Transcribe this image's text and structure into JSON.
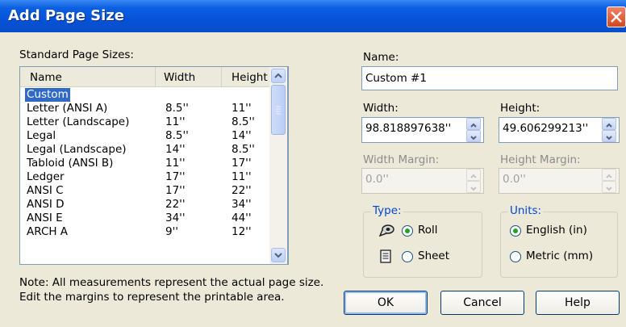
{
  "window": {
    "title": "Add Page Size"
  },
  "left": {
    "list_label": "Standard Page Sizes:",
    "columns": [
      "Name",
      "Width",
      "Height"
    ],
    "rows": [
      {
        "name": "Custom",
        "width": "",
        "height": ""
      },
      {
        "name": "Letter (ANSI A)",
        "width": "8.5''",
        "height": "11''"
      },
      {
        "name": "Letter (Landscape)",
        "width": "11''",
        "height": "8.5''"
      },
      {
        "name": "Legal",
        "width": "8.5''",
        "height": "14''"
      },
      {
        "name": "Legal (Landscape)",
        "width": "14''",
        "height": "8.5''"
      },
      {
        "name": "Tabloid (ANSI B)",
        "width": "11''",
        "height": "17''"
      },
      {
        "name": "Ledger",
        "width": "17''",
        "height": "11''"
      },
      {
        "name": "ANSI C",
        "width": "17''",
        "height": "22''"
      },
      {
        "name": "ANSI D",
        "width": "22''",
        "height": "34''"
      },
      {
        "name": "ANSI E",
        "width": "34''",
        "height": "44''"
      },
      {
        "name": "ARCH A",
        "width": "9''",
        "height": "12''"
      }
    ],
    "note_line1": "Note:  All measurements represent the actual page size.",
    "note_line2": "Edit the margins to represent the printable area."
  },
  "right": {
    "name_label": "Name:",
    "name_value": "Custom #1",
    "width_label": "Width:",
    "width_value": "98.818897638''",
    "height_label": "Height:",
    "height_value": "49.606299213''",
    "width_margin_label": "Width Margin:",
    "width_margin_value": "0.0''",
    "height_margin_label": "Height Margin:",
    "height_margin_value": "0.0''",
    "type_group": "Type:",
    "type_roll": "Roll",
    "type_sheet": "Sheet",
    "units_group": "Units:",
    "units_english": "English (in)",
    "units_metric": "Metric (mm)"
  },
  "buttons": {
    "ok": "OK",
    "cancel": "Cancel",
    "help": "Help"
  },
  "colors": {
    "titlebar": "#0a5fe0",
    "selection": "#316ac5",
    "group_label": "#0046d5"
  }
}
